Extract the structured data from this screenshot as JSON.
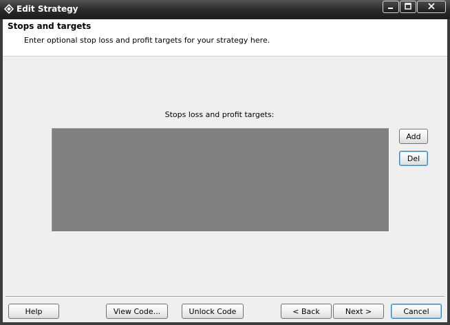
{
  "window": {
    "title": "Edit Strategy",
    "controls": {
      "minimize": "minimize",
      "maximize": "maximize",
      "close": "close"
    }
  },
  "header": {
    "title": "Stops and targets",
    "subtitle": "Enter optional stop loss and profit targets for your strategy here."
  },
  "main": {
    "list_label": "Stops loss and profit targets:",
    "list_items": [],
    "add_label": "Add",
    "del_label": "Del"
  },
  "footer": {
    "help_label": "Help",
    "view_code_label": "View Code...",
    "unlock_code_label": "Unlock Code",
    "back_label": "< Back",
    "next_label": "Next >",
    "cancel_label": "Cancel"
  },
  "colors": {
    "titlebar": "#2e2e2e",
    "client_bg": "#efefef",
    "listbox_bg": "#808080",
    "focus_border": "#3c7fb1"
  }
}
